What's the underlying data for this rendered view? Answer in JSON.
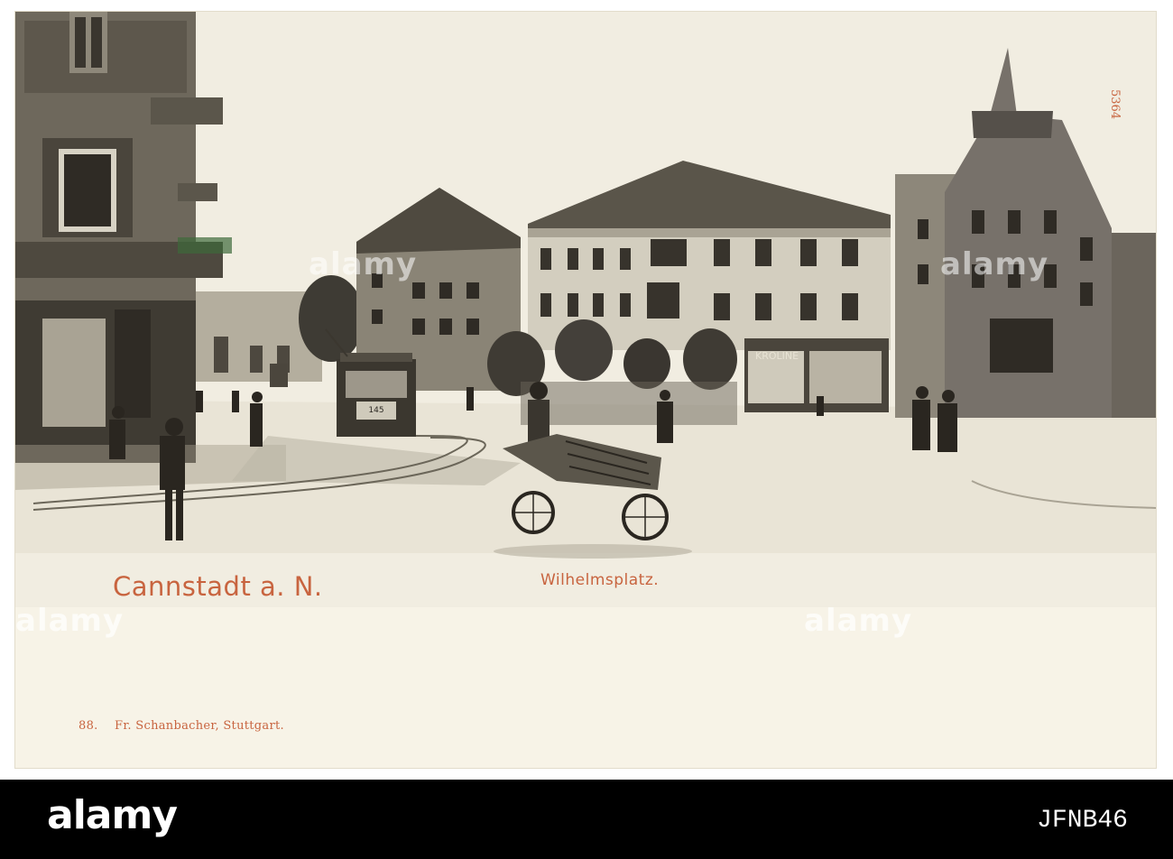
{
  "postcard": {
    "town": "Cannstadt a. N.",
    "place": "Wilhelmsplatz.",
    "publisher_number": "88.",
    "publisher": "Fr. Schanbacher, Stuttgart.",
    "card_number": "5364",
    "tram_number": "145",
    "shop_sign": "KROLINE",
    "ink_color": "#c8643f"
  },
  "watermark": {
    "text": "alamy"
  },
  "footer": {
    "logo": "alamy",
    "image_code": "JFNB46"
  }
}
